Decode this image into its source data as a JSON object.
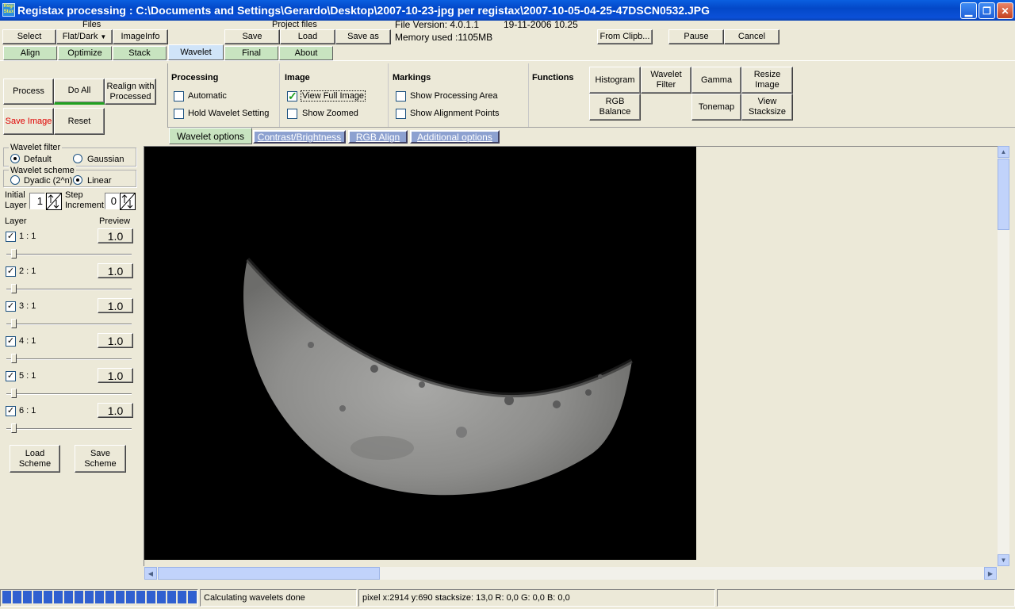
{
  "window": {
    "title": "Registax processing : C:\\Documents and Settings\\Gerardo\\Desktop\\2007-10-23-jpg per registax\\2007-10-05-04-25-47DSCN0532.JPG",
    "app_icon_text": "Regi Stax"
  },
  "files": {
    "label": "Files",
    "select": "Select",
    "flatdark": "Flat/Dark",
    "imageinfo": "ImageInfo"
  },
  "project": {
    "label": "Project files",
    "save": "Save",
    "load": "Load",
    "save_as": "Save as"
  },
  "info": {
    "file_version": "File Version: 4.0.1.1",
    "date": "19-11-2006 10.25",
    "memory": "Memory used :1105MB"
  },
  "top_buttons": {
    "from_clip": "From Clipb...",
    "pause": "Pause",
    "cancel": "Cancel"
  },
  "tabs": [
    "Align",
    "Optimize",
    "Stack",
    "Wavelet",
    "Final",
    "About"
  ],
  "actions": {
    "process": "Process",
    "do_all": "Do All",
    "realign": "Realign with Processed",
    "save_image": "Save Image",
    "reset": "Reset"
  },
  "processing": {
    "title": "Processing",
    "automatic": "Automatic",
    "hold": "Hold Wavelet Setting"
  },
  "image": {
    "title": "Image",
    "view_full": "View Full Image",
    "show_zoomed": "Show Zoomed"
  },
  "markings": {
    "title": "Markings",
    "show_area": "Show Processing Area",
    "show_points": "Show Alignment Points"
  },
  "functions": {
    "title": "Functions",
    "histogram": "Histogram",
    "wavelet_filter": "Wavelet Filter",
    "gamma": "Gamma",
    "resize": "Resize Image",
    "rgb": "RGB Balance",
    "tonemap": "Tonemap",
    "stacksize": "View Stacksize"
  },
  "subtabs": [
    "Wavelet options",
    "Contrast/Brightness",
    "RGB Align",
    "Additional options"
  ],
  "wavelet_filter": {
    "title": "Wavelet filter",
    "default": "Default",
    "gaussian": "Gaussian"
  },
  "wavelet_scheme": {
    "title": "Wavelet scheme",
    "dyadic": "Dyadic (2^n)",
    "linear": "Linear"
  },
  "initial": {
    "label1": "Initial",
    "label2": "Layer",
    "value": "1"
  },
  "step": {
    "label1": "Step",
    "label2": "Increment",
    "value": "0"
  },
  "layer_header": {
    "layer": "Layer",
    "preview": "Preview"
  },
  "layers": [
    {
      "name": "1 : 1",
      "value": "1.0"
    },
    {
      "name": "2 : 1",
      "value": "1.0"
    },
    {
      "name": "3 : 1",
      "value": "1.0"
    },
    {
      "name": "4 : 1",
      "value": "1.0"
    },
    {
      "name": "5 : 1",
      "value": "1.0"
    },
    {
      "name": "6 : 1",
      "value": "1.0"
    }
  ],
  "scheme_buttons": {
    "load": "Load Scheme",
    "save": "Save Scheme"
  },
  "status": {
    "message": "Calculating wavelets done",
    "pixel": "pixel x:2914 y:690 stacksize: 13,0 R: 0,0 G: 0,0 B: 0,0",
    "progress_fraction": 1.0
  },
  "colors": {
    "title_blue": "#0348c8",
    "tab_green": "#c8e4c0",
    "save_red": "#e00000",
    "progress_blue": "#3060d0"
  }
}
